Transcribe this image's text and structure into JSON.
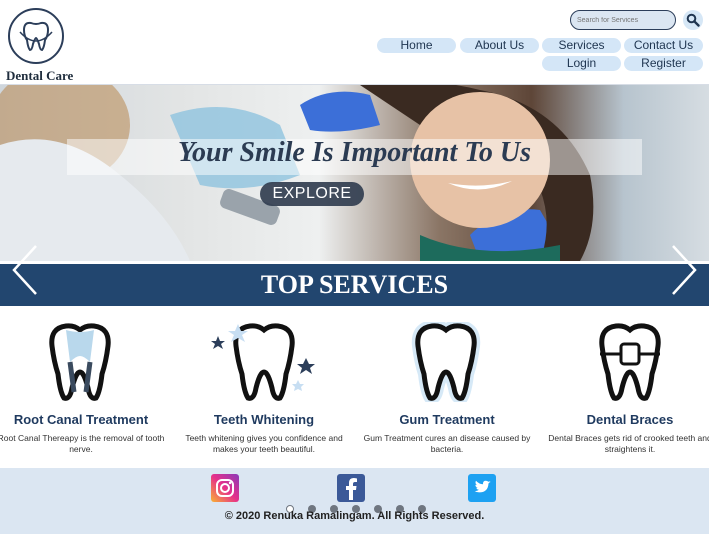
{
  "header": {
    "brand": "Dental Care",
    "search_placeholder": "Search for Services"
  },
  "nav": {
    "home": "Home",
    "about": "About Us",
    "services": "Services",
    "contact": "Contact Us",
    "login": "Login",
    "register": "Register"
  },
  "hero": {
    "title": "Your Smile Is Important To Us",
    "cta": "EXPLORE"
  },
  "services": {
    "heading": "TOP SERVICES",
    "items": [
      {
        "title": "Root Canal Treatment",
        "desc": "Root Canal Thereapy is the removal of tooth nerve.",
        "icon": "root-canal-tooth-icon"
      },
      {
        "title": "Teeth Whitening",
        "desc": "Teeth whitening gives you confidence and makes your teeth beautiful.",
        "icon": "sparkling-tooth-icon"
      },
      {
        "title": "Gum Treatment",
        "desc": "Gum Treatment cures an disease caused by bacteria.",
        "icon": "healthy-tooth-icon"
      },
      {
        "title": "Dental Braces",
        "desc": "Dental Braces gets rid of crooked teeth and straightens it.",
        "icon": "braces-tooth-icon"
      }
    ]
  },
  "footer": {
    "copyright": "© 2020 Renuka Ramalingam. All Rights Reserved.",
    "social": [
      "instagram-icon",
      "facebook-icon",
      "twitter-icon"
    ]
  },
  "slider": {
    "dot_count": 7,
    "active_index": 0
  },
  "colors": {
    "primary": "#22466f",
    "nav_bg": "#d4e6f7",
    "footer_bg": "#dbe6f2"
  }
}
